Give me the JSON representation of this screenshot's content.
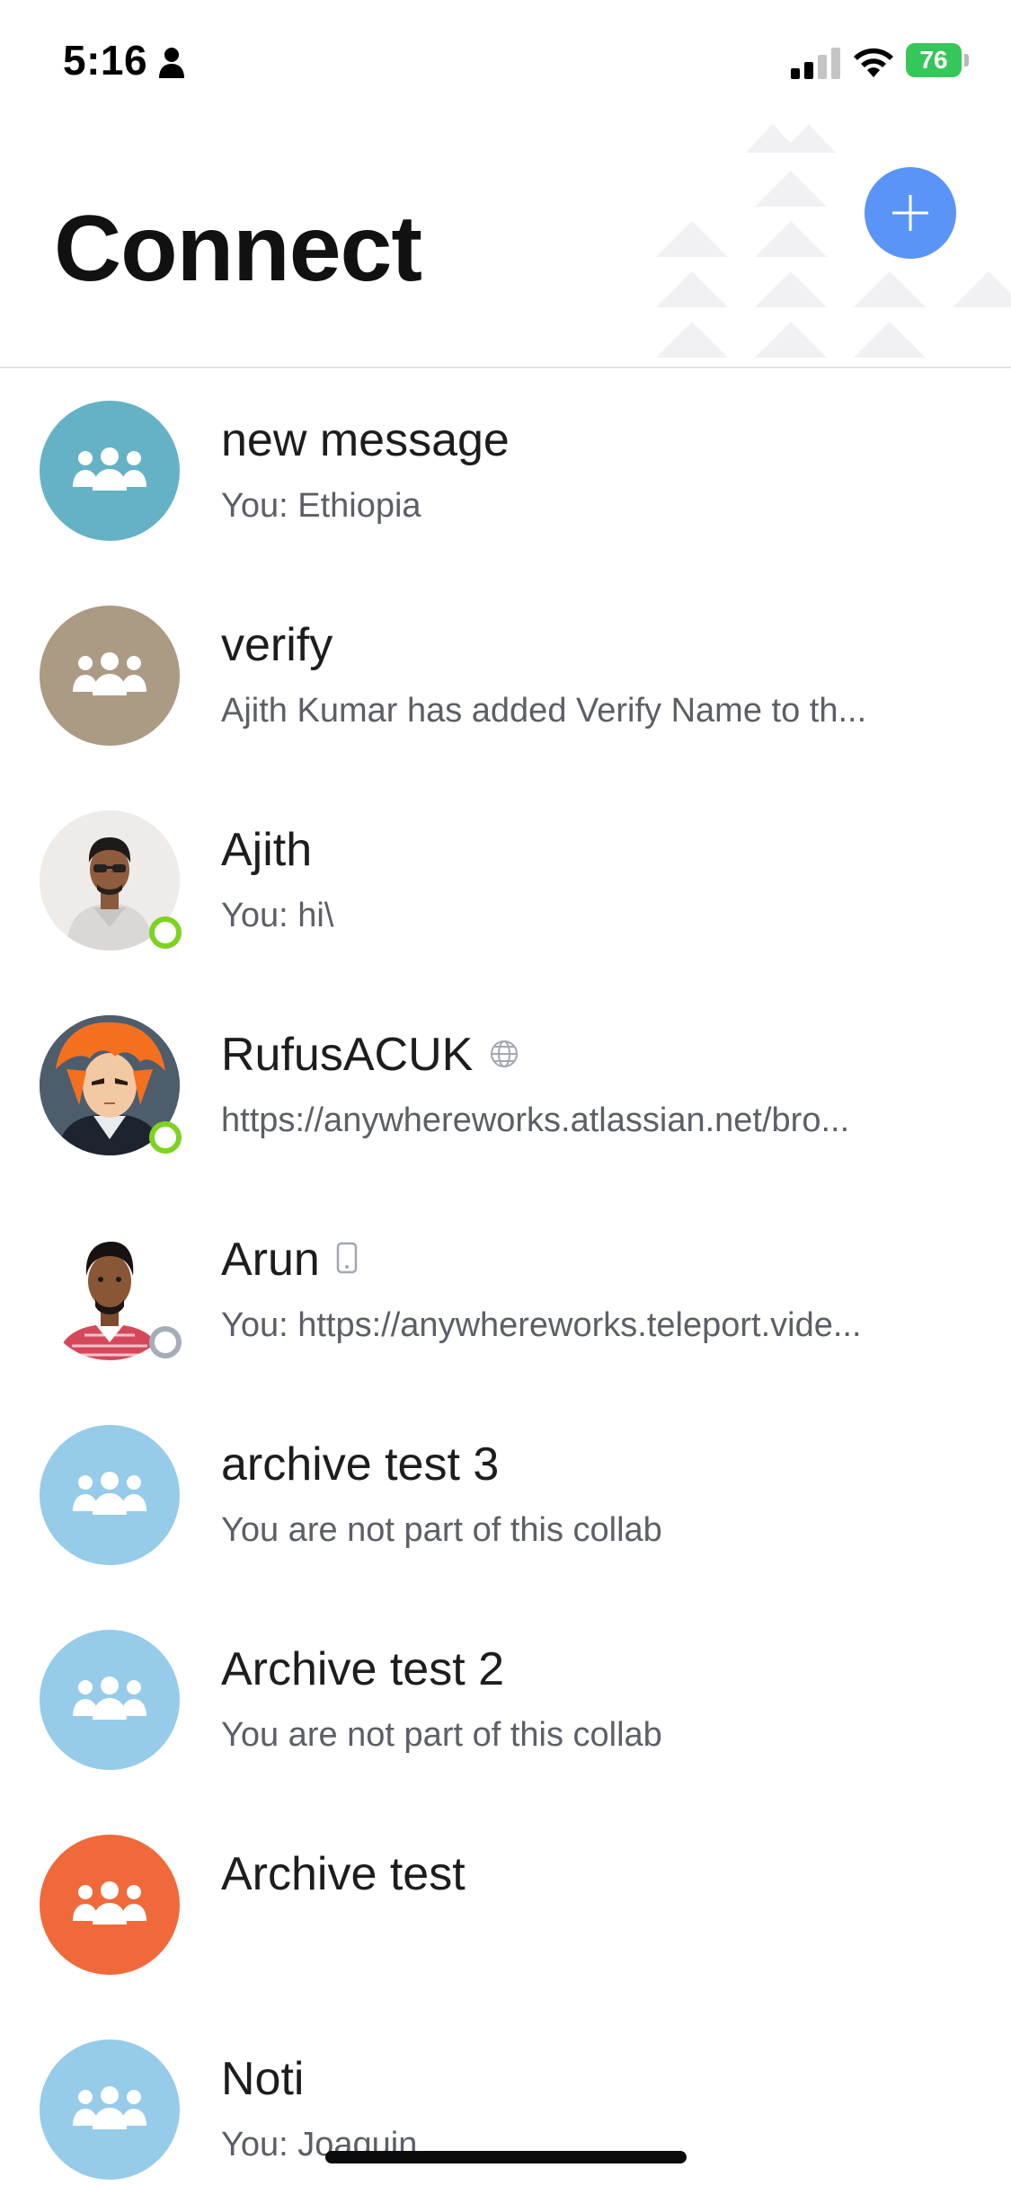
{
  "status_bar": {
    "time": "5:16",
    "battery": "76"
  },
  "header": {
    "title": "Connect",
    "add_icon": "plus-icon"
  },
  "colors": {
    "accent": "#5b94f7",
    "online": "#7ed321",
    "offline": "#a7acb9"
  },
  "conversations": [
    {
      "title": "new message",
      "subtitle": "You: Ethiopia",
      "avatar": "group-icon",
      "avatar_color": "#65b2c6"
    },
    {
      "title": "verify",
      "subtitle": "Ajith Kumar has added Verify Name to th...",
      "avatar": "group-icon",
      "avatar_color": "#ab9a84"
    },
    {
      "title": "Ajith",
      "subtitle": "You: hi\\",
      "avatar": "user-photo",
      "presence": "online"
    },
    {
      "title": "RufusACUK",
      "subtitle": "https://anywhereworks.atlassian.net/bro...",
      "avatar": "user-photo",
      "presence": "online",
      "badge": "globe-icon"
    },
    {
      "title": "Arun",
      "subtitle": "You: https://anywhereworks.teleport.vide...",
      "avatar": "user-photo",
      "presence": "offline",
      "badge": "mobile-icon"
    },
    {
      "title": "archive test 3",
      "subtitle": "You are not part of this collab",
      "avatar": "group-icon",
      "avatar_color": "#96cbe9"
    },
    {
      "title": "Archive test 2",
      "subtitle": "You are not part of this collab",
      "avatar": "group-icon",
      "avatar_color": "#96cbe9"
    },
    {
      "title": "Archive test",
      "subtitle": "",
      "avatar": "group-icon",
      "avatar_color": "#f0693b"
    },
    {
      "title": "Noti",
      "subtitle": "You: Joaquin",
      "avatar": "group-icon",
      "avatar_color": "#96cbe9"
    }
  ]
}
